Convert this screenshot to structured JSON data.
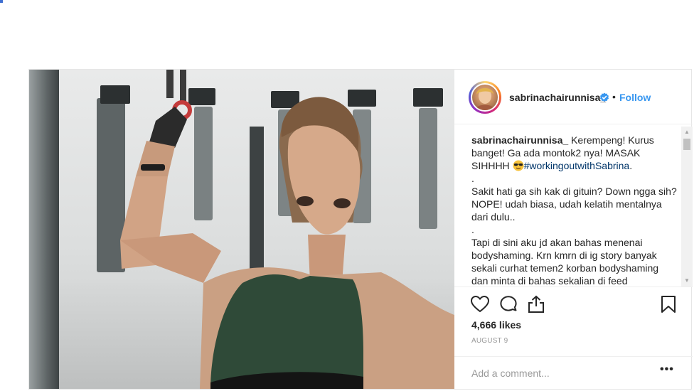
{
  "post": {
    "username": "sabrinachairunnisa_",
    "separator": "•",
    "follow_label": "Follow",
    "caption": {
      "username": "sabrinachairunnisa_",
      "intro": " Kerempeng! Kurus banget! Ga ada montok2 nya! MASAK SIHHHH ",
      "hashtag": "#workingoutwithSabrina",
      "intro_end": ".",
      "dot1": ".",
      "para2": "Sakit hati ga sih kak di gituin? Down ngga sih? NOPE! udah biasa, udah kelatih mentalnya dari dulu..",
      "dot2": ".",
      "para3": "Tapi di sini aku jd akan bahas menenai bodyshaming. Krn kmrn di ig story banyak sekali curhat temen2 korban bodyshaming dan minta di bahas sekalian di feed"
    },
    "likes": "4,666 likes",
    "date": "AUGUST 9",
    "comment_placeholder": "Add a comment...",
    "more_label": "•••"
  },
  "icons": {
    "like": "heart-icon",
    "comment": "comment-icon",
    "share": "share-icon",
    "save": "bookmark-icon",
    "verified": "verified-badge-icon"
  },
  "colors": {
    "link": "#3897f0",
    "verified": "#3897f0",
    "hashtag": "#003569",
    "muted": "#999999",
    "border": "#efefef"
  }
}
